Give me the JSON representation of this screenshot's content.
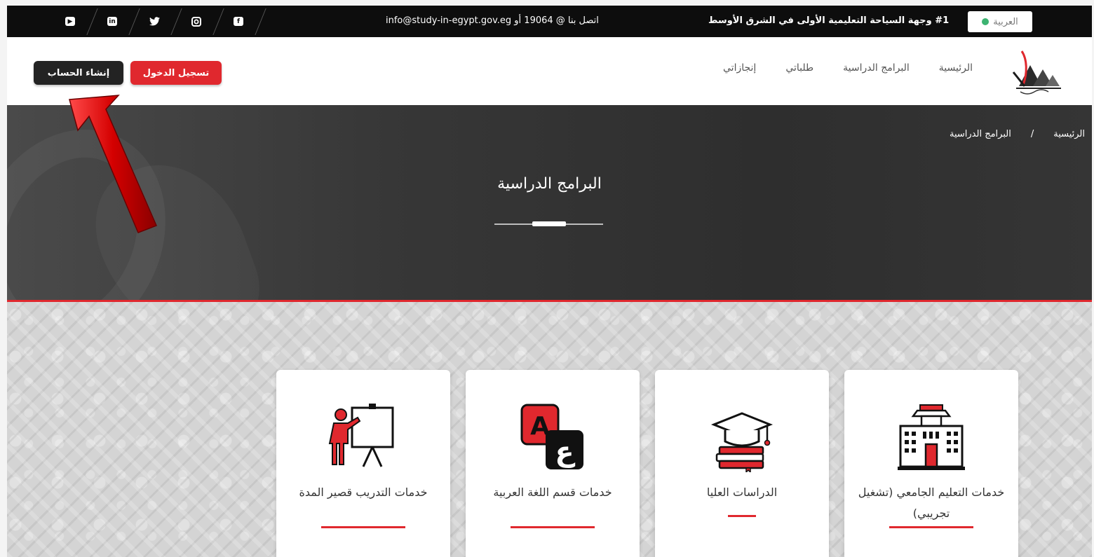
{
  "topbar": {
    "language_label": "العربية",
    "slogan": "#1 وجهة السياحة التعليمية الأولى في الشرق الأوسط",
    "contact": "اتصل بنا @ 19064 أو info@study-in-egypt.gov.eg",
    "social_icons": [
      "facebook-icon",
      "instagram-icon",
      "twitter-icon",
      "linkedin-icon",
      "youtube-icon"
    ]
  },
  "nav": {
    "links": [
      "الرئيسية",
      "البرامج الدراسية",
      "طلباتي",
      "إنجازاتي"
    ],
    "login_label": "تسجيل الدخول",
    "register_label": "إنشاء الحساب"
  },
  "hero": {
    "breadcrumb_home": "الرئيسية",
    "breadcrumb_sep": "/",
    "breadcrumb_current": "البرامج الدراسية",
    "title": "البرامج الدراسية"
  },
  "cards": [
    {
      "label": "خدمات التعليم الجامعي (تشغيل تجريبي)",
      "icon": "university-building-icon"
    },
    {
      "label": "الدراسات العليا",
      "icon": "graduation-cap-books-icon"
    },
    {
      "label": "خدمات قسم اللغة العربية",
      "icon": "language-letters-icon"
    },
    {
      "label": "خدمات التدريب قصير المدة",
      "icon": "trainer-presentation-icon"
    }
  ],
  "colors": {
    "accent_red": "#e0282e",
    "topbar_black": "#0d0d0d",
    "hero_gray": "#373737"
  }
}
